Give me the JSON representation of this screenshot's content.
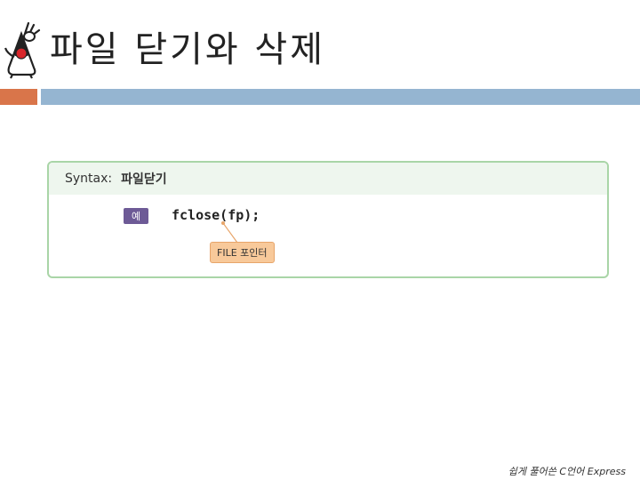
{
  "slide": {
    "title": "파일 닫기와 삭제",
    "footer": "쉽게 풀어쓴 C언어 Express"
  },
  "syntax": {
    "label": "Syntax:",
    "name": "파일닫기",
    "example_badge": "예",
    "code": "fclose(fp);",
    "callout": "FILE 포인터"
  },
  "icons": {
    "mascot": "duke-java-mascot-icon"
  },
  "colors": {
    "accent_orange": "#d9754a",
    "accent_blue": "#95b5d1",
    "syntax_border": "#a9d5a7",
    "badge_purple": "#6d5a96",
    "callout_fill": "#f8c99a"
  }
}
